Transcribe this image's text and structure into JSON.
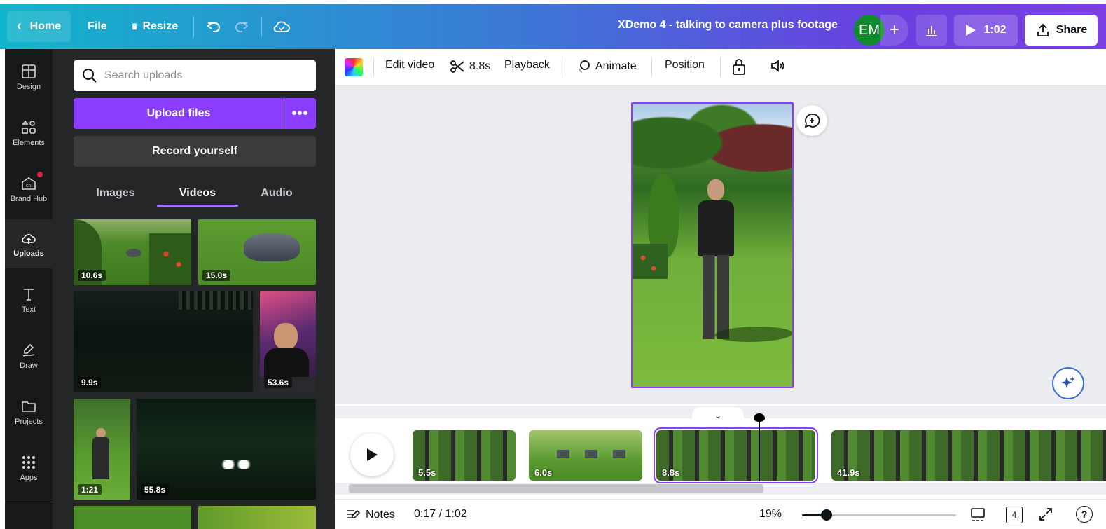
{
  "topbar": {
    "home_label": "Home",
    "file_label": "File",
    "resize_label": "Resize",
    "doc_title": "XDemo 4 - talking to camera plus footage",
    "avatar_initials": "EM",
    "add_collab": "+",
    "present_duration": "1:02",
    "share_label": "Share"
  },
  "rail": {
    "items": [
      {
        "label": "Design",
        "icon": "layout-icon"
      },
      {
        "label": "Elements",
        "icon": "shapes-icon"
      },
      {
        "label": "Brand Hub",
        "icon": "brand-hub-icon"
      },
      {
        "label": "Uploads",
        "icon": "cloud-upload-icon"
      },
      {
        "label": "Text",
        "icon": "text-icon"
      },
      {
        "label": "Draw",
        "icon": "draw-icon"
      },
      {
        "label": "Projects",
        "icon": "folder-icon"
      },
      {
        "label": "Apps",
        "icon": "apps-grid-icon"
      }
    ],
    "active": "Uploads"
  },
  "panel": {
    "search_placeholder": "Search uploads",
    "upload_label": "Upload files",
    "upload_more": "•••",
    "record_label": "Record yourself",
    "tabs": [
      "Images",
      "Videos",
      "Audio"
    ],
    "active_tab": "Videos",
    "videos": [
      {
        "duration": "10.6s",
        "scene": "robot-mower-lawn"
      },
      {
        "duration": "15.0s",
        "scene": "robot-mower-closeup"
      },
      {
        "duration": "9.9s",
        "scene": "night-lawn-dark"
      },
      {
        "duration": "53.6s",
        "scene": "man-at-desk"
      },
      {
        "duration": "1:21",
        "scene": "man-in-garden"
      },
      {
        "duration": "55.8s",
        "scene": "mower-headlights-night"
      }
    ]
  },
  "toolbar": {
    "color_icon": "color-swatch-icon",
    "edit_video": "Edit video",
    "trim_duration": "8.8s",
    "playback": "Playback",
    "animate": "Animate",
    "position": "Position"
  },
  "timeline": {
    "clips": [
      {
        "duration": "5.5s",
        "scene": "man-in-garden"
      },
      {
        "duration": "6.0s",
        "scene": "robot-mower-lawn"
      },
      {
        "duration": "8.8s",
        "scene": "man-in-garden",
        "selected": true
      },
      {
        "duration": "41.9s",
        "scene": "man-in-garden"
      }
    ]
  },
  "footer": {
    "notes_label": "Notes",
    "time_readout": "0:17 / 1:02",
    "zoom_percent": "19%",
    "page_count": "4",
    "help": "?"
  },
  "colors": {
    "accent": "#8b3dff",
    "panel_bg": "#252627",
    "rail_bg": "#18191b",
    "canvas_bg": "#ebecf0",
    "avatar_bg": "#0f8a2c"
  }
}
